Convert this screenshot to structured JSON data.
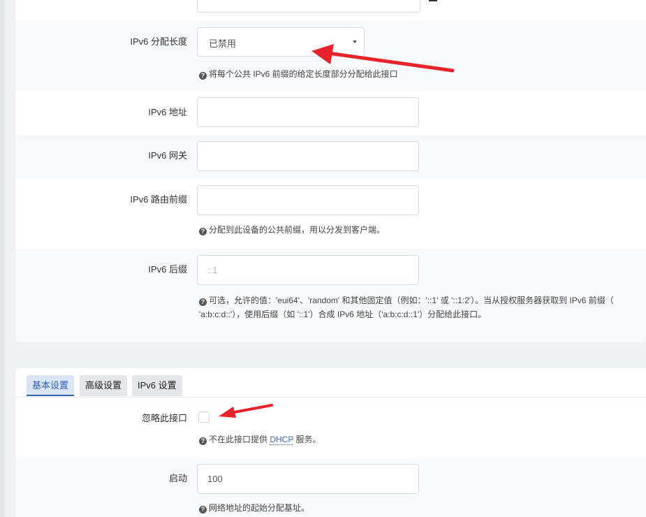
{
  "section1": {
    "ipv6_assign_length": {
      "label": "IPv6 分配长度",
      "value": "已禁用",
      "hint": "将每个公共 IPv6 前缀的给定长度部分分配给此接口"
    },
    "ipv6_address": {
      "label": "IPv6 地址",
      "value": ""
    },
    "ipv6_gateway": {
      "label": "IPv6 网关",
      "value": ""
    },
    "ipv6_prefix": {
      "label": "IPv6 路由前缀",
      "value": "",
      "hint": "分配到此设备的公共前缀，用以分发到客户端。"
    },
    "ipv6_suffix": {
      "label": "IPv6 后缀",
      "placeholder": "::1",
      "hint_line1": "可选，允许的值：'eui64'、'random' 和其他固定值（例如：'::1' 或 '::1:2'）。当从授权服务器获取到 IPv6 前缀（",
      "hint_line2": "'a:b:c:d::'），使用后缀（如 '::1'）合成 IPv6 地址（'a:b:c:d::1'）分配给此接口。"
    }
  },
  "section2": {
    "tabs": [
      "基本设置",
      "高级设置",
      "IPv6 设置"
    ],
    "ignore_interface": {
      "label": "忽略此接口",
      "hint_prefix": "不在此接口提供 ",
      "hint_link": "DHCP",
      "hint_suffix": " 服务。"
    },
    "start": {
      "label": "启动",
      "value": "100",
      "hint": "网络地址的起始分配基址。"
    }
  },
  "annotation_color": "#e8232b"
}
